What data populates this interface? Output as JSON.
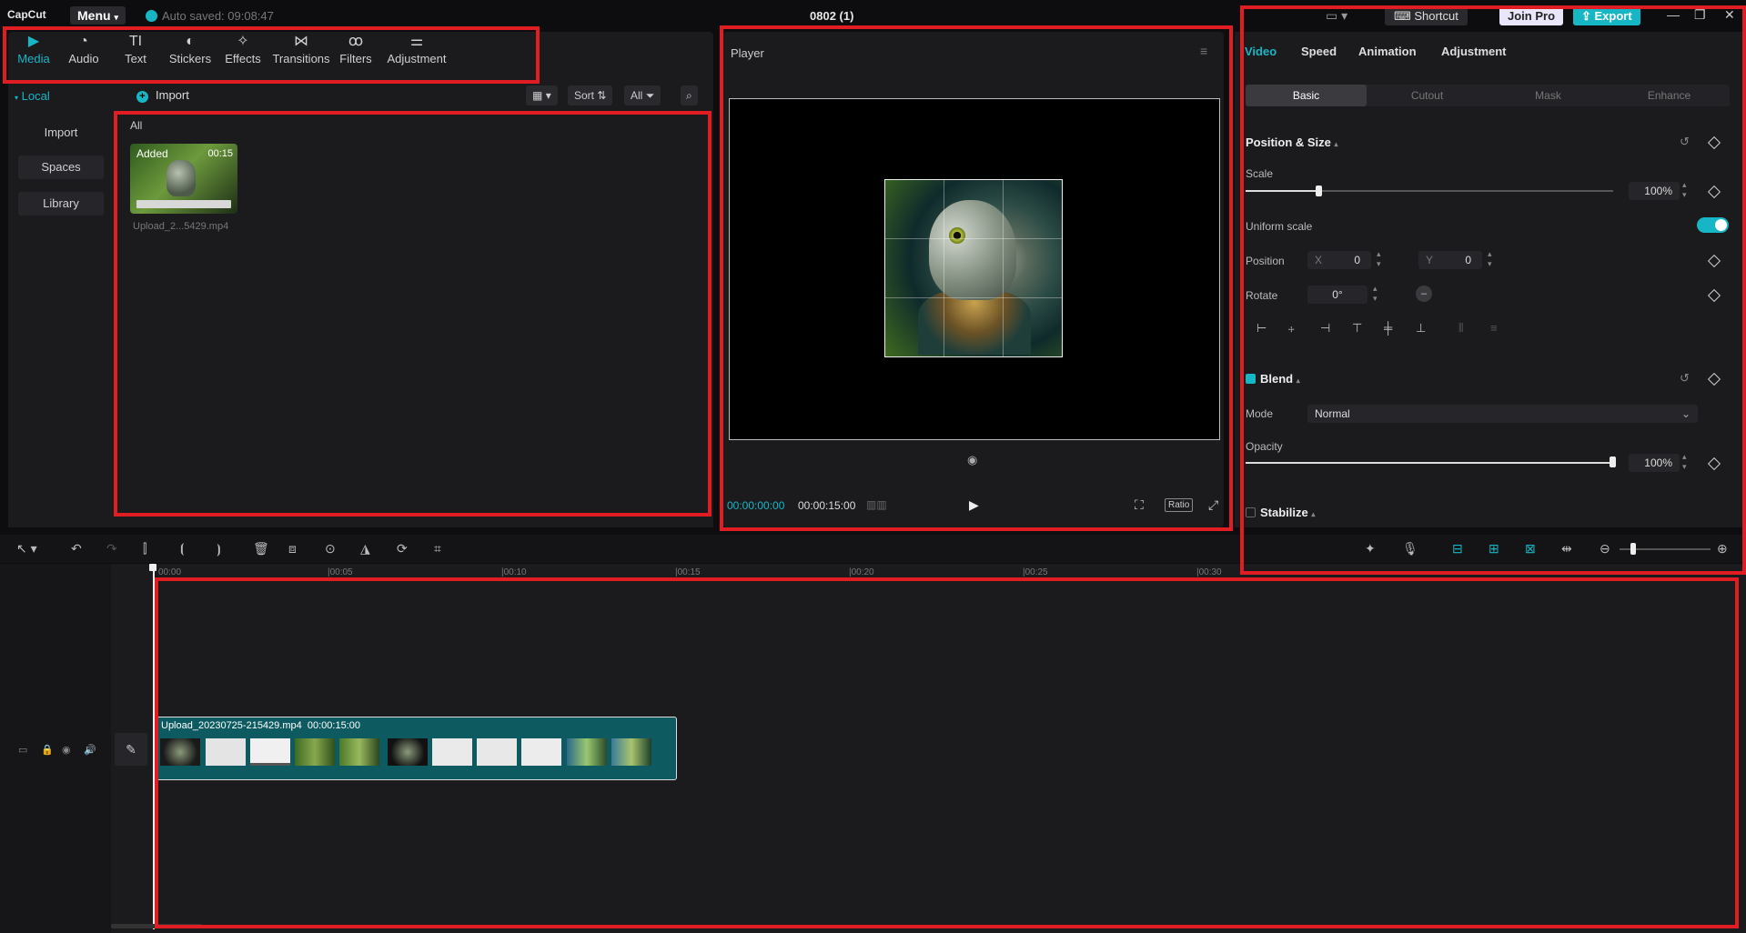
{
  "app": {
    "logo_text": "CapCut",
    "menu_label": "Menu",
    "autosave_text": "Auto saved: 09:08:47",
    "doc_title": "0802 (1)",
    "shortcut_label": "Shortcut",
    "joinpro_label": "Join Pro",
    "export_label": "Export"
  },
  "media_panel": {
    "tabs": [
      {
        "label": "Media",
        "icon": "media-icon",
        "active": true
      },
      {
        "label": "Audio",
        "icon": "audio-icon"
      },
      {
        "label": "Text",
        "icon": "text-icon"
      },
      {
        "label": "Stickers",
        "icon": "stickers-icon"
      },
      {
        "label": "Effects",
        "icon": "effects-icon"
      },
      {
        "label": "Transitions",
        "icon": "transitions-icon"
      },
      {
        "label": "Filters",
        "icon": "filters-icon"
      },
      {
        "label": "Adjustment",
        "icon": "adjustment-icon"
      }
    ],
    "sidebar": {
      "local_label": "Local",
      "items": [
        {
          "label": "Import"
        },
        {
          "label": "Spaces"
        },
        {
          "label": "Library"
        }
      ]
    },
    "import_label": "Import",
    "sort_label": "Sort",
    "filter_label": "All",
    "section_label": "All",
    "items": [
      {
        "badge": "Added",
        "duration": "00:15",
        "name": "Upload_2...5429.mp4"
      }
    ]
  },
  "player": {
    "title": "Player",
    "current_time": "00:00:00:00",
    "total_time": "00:00:15:00",
    "ratio_label": "Ratio"
  },
  "properties": {
    "tabs": [
      {
        "label": "Video",
        "active": true
      },
      {
        "label": "Speed"
      },
      {
        "label": "Animation"
      },
      {
        "label": "Adjustment"
      }
    ],
    "subtabs": [
      {
        "label": "Basic",
        "active": true
      },
      {
        "label": "Cutout"
      },
      {
        "label": "Mask"
      },
      {
        "label": "Enhance"
      }
    ],
    "position_size": {
      "heading": "Position & Size",
      "scale_label": "Scale",
      "scale_value": "100%",
      "scale_fraction": 0.2,
      "uniform_label": "Uniform scale",
      "uniform_on": true,
      "position_label": "Position",
      "x_label": "X",
      "x_value": "0",
      "y_label": "Y",
      "y_value": "0",
      "rotate_label": "Rotate",
      "rotate_value": "0°"
    },
    "blend": {
      "heading": "Blend",
      "mode_label": "Mode",
      "mode_value": "Normal",
      "opacity_label": "Opacity",
      "opacity_value": "100%",
      "opacity_fraction": 1.0
    },
    "stabilize": {
      "heading": "Stabilize"
    }
  },
  "timeline": {
    "ticks": [
      "00:00",
      "|00:05",
      "|00:10",
      "|00:15",
      "|00:20",
      "|00:25",
      "|00:30"
    ],
    "clip_name": "Upload_20230725-215429.mp4",
    "clip_duration": "00:00:15:00"
  },
  "colors": {
    "accent": "#17b6c4",
    "annotation": "#e11d24"
  }
}
